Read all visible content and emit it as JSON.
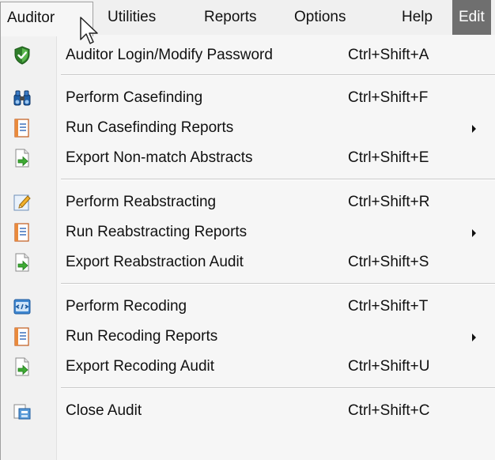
{
  "menubar": {
    "items": [
      "Auditor",
      "Utilities",
      "Reports",
      "Options",
      "Help",
      "Edit"
    ]
  },
  "menu": {
    "items": [
      {
        "label": "Auditor Login/Modify Password",
        "shortcut": "Ctrl+Shift+A",
        "icon": "shield-check-icon"
      },
      {
        "label": "Perform Casefinding",
        "shortcut": "Ctrl+Shift+F",
        "icon": "binoculars-icon"
      },
      {
        "label": "Run Casefinding Reports",
        "shortcut": "",
        "icon": "report-icon",
        "submenu": true
      },
      {
        "label": "Export Non-match Abstracts",
        "shortcut": "Ctrl+Shift+E",
        "icon": "export-arrow-icon"
      },
      {
        "label": "Perform Reabstracting",
        "shortcut": "Ctrl+Shift+R",
        "icon": "pencil-icon"
      },
      {
        "label": "Run Reabstracting Reports",
        "shortcut": "",
        "icon": "report-icon",
        "submenu": true
      },
      {
        "label": "Export Reabstraction Audit",
        "shortcut": "Ctrl+Shift+S",
        "icon": "export-arrow-icon"
      },
      {
        "label": "Perform Recoding",
        "shortcut": "Ctrl+Shift+T",
        "icon": "recode-icon"
      },
      {
        "label": "Run Recoding Reports",
        "shortcut": "",
        "icon": "report-icon",
        "submenu": true
      },
      {
        "label": "Export Recoding Audit",
        "shortcut": "Ctrl+Shift+U",
        "icon": "export-arrow-icon"
      },
      {
        "label": "Close Audit",
        "shortcut": "Ctrl+Shift+C",
        "icon": "close-audit-icon"
      }
    ]
  },
  "colors": {
    "menu_bg": "#f6f6f6",
    "highlight_bg": "#6f6f6f",
    "separator": "#c9c9c9"
  }
}
